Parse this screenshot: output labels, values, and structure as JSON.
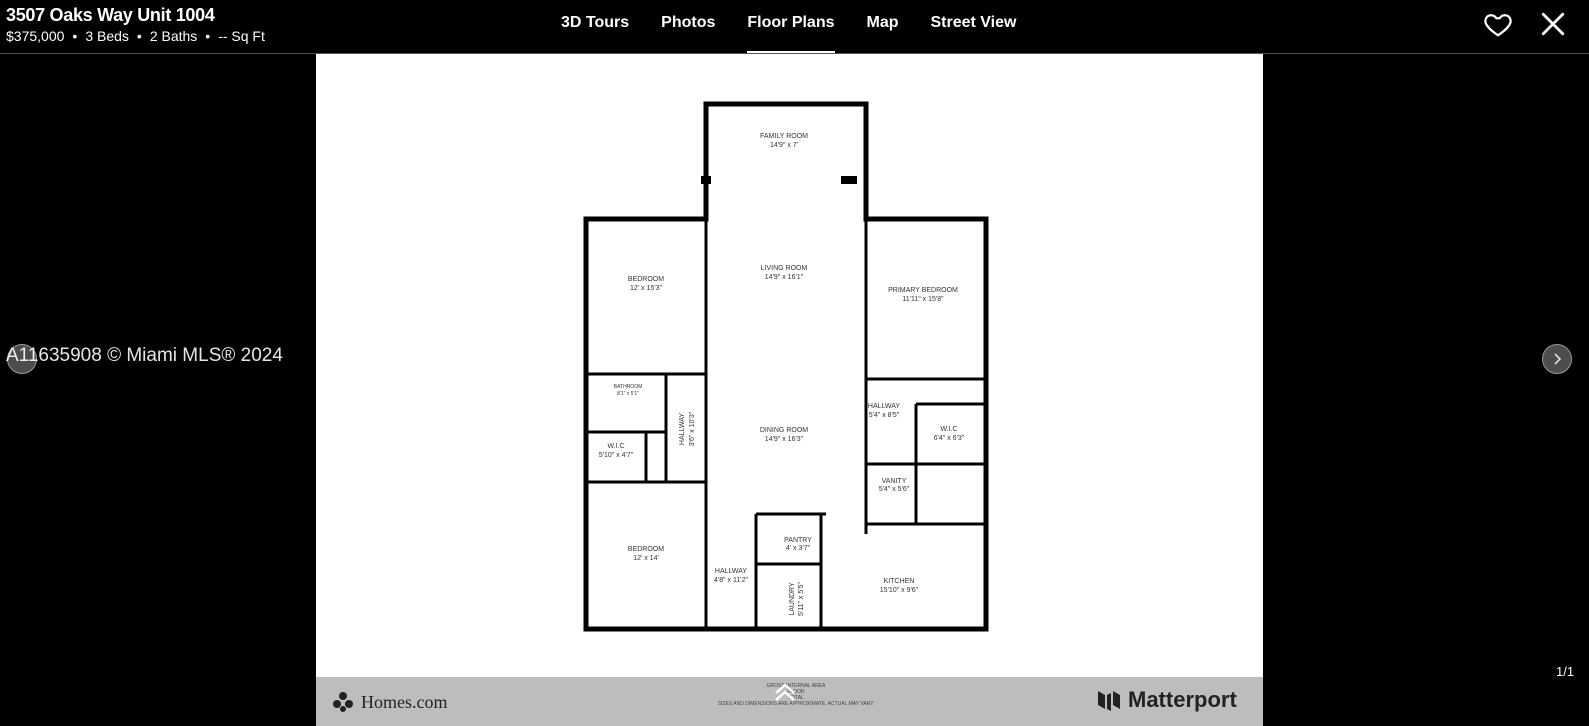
{
  "listing": {
    "address": "3507 Oaks Way Unit 1004",
    "price": "$375,000",
    "beds": "3 Beds",
    "baths": "2 Baths",
    "sqft": "-- Sq Ft"
  },
  "tabs": [
    {
      "label": "3D Tours"
    },
    {
      "label": "Photos"
    },
    {
      "label": "Floor Plans",
      "active": true
    },
    {
      "label": "Map"
    },
    {
      "label": "Street View"
    }
  ],
  "icons": {
    "favorite": "heart-icon",
    "close": "close-icon",
    "next": "chevron-right-icon"
  },
  "watermark": "A11635908 © Miami MLS® 2024",
  "counter": "1/1",
  "floorplan": {
    "rooms": [
      {
        "name": "FAMILY ROOM",
        "dims": "14'9\" x 7'"
      },
      {
        "name": "LIVING ROOM",
        "dims": "14'9\" x 16'1\""
      },
      {
        "name": "BEDROOM",
        "dims": "12' x 15'3\""
      },
      {
        "name": "PRIMARY BEDROOM",
        "dims": "11'11\" x 15'8\""
      },
      {
        "name": "BATHROOM",
        "dims": "8'1\" x 5'1\""
      },
      {
        "name": "HALLWAY",
        "dims": "3'6\" x 10'3\""
      },
      {
        "name": "W.I.C",
        "dims": "5'10\" x 4'7\""
      },
      {
        "name": "DINING ROOM",
        "dims": "14'9\" x 16'3\""
      },
      {
        "name": "HALLWAY",
        "dims": "5'4\" x 8'5\""
      },
      {
        "name": "W.I.C",
        "dims": "6'4\" x 6'3\""
      },
      {
        "name": "VANITY",
        "dims": "5'4\" x 5'6\""
      },
      {
        "name": "BEDROOM",
        "dims": "12' x 14'"
      },
      {
        "name": "PANTRY",
        "dims": "4' x 3'7\""
      },
      {
        "name": "HALLWAY",
        "dims": "4'8\" x 11'2\""
      },
      {
        "name": "LAUNDRY",
        "dims": "5'11\" x 5'5\""
      },
      {
        "name": "KITCHEN",
        "dims": "15'10\" x 9'6\""
      }
    ],
    "footer": {
      "gross_line1": "GROSS INTERNAL AREA",
      "gross_line2": "FLOOR",
      "gross_line3": "TOTAL",
      "disclaimer": "SIZES AND DIMENSIONS ARE APPROXIMATE, ACTUAL MAY VARY."
    },
    "brand_left": "Homes.com",
    "brand_right": "Matterport"
  }
}
